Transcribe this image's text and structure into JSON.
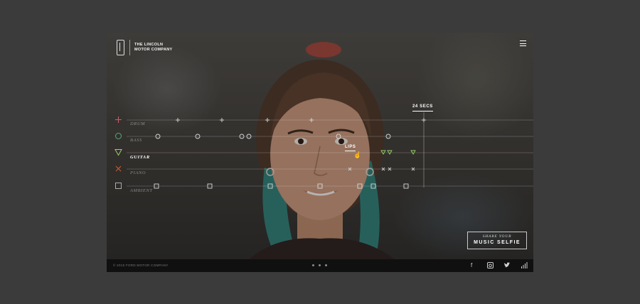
{
  "brand": {
    "line1": "THE LINCOLN",
    "line2": "MOTOR COMPANY"
  },
  "menu": {
    "icon": "hamburger-menu-icon"
  },
  "tracks": [
    {
      "label": "DRUM",
      "icon": "plus-icon",
      "color": "#c9606a",
      "active": false
    },
    {
      "label": "BASS",
      "icon": "circle-icon",
      "color": "#5aa77a",
      "active": false
    },
    {
      "label": "GUITAR",
      "icon": "triangle-icon",
      "color": "#9ad06a",
      "active": true
    },
    {
      "label": "PIANO",
      "icon": "cross-icon",
      "color": "#c8603c",
      "active": false
    },
    {
      "label": "AMBIENT",
      "icon": "square-icon",
      "color": "#aaaaaa",
      "active": false
    }
  ],
  "timer": "24 SECS",
  "hotspot": "LIPS",
  "share": {
    "line1": "SHARE YOUR",
    "line2": "MUSIC SELFIE"
  },
  "footer": {
    "copyright": "© 2015 FORD MOTOR COMPANY",
    "slides": 3,
    "social": [
      "facebook-icon",
      "instagram-icon",
      "twitter-icon",
      "signal-bars-icon"
    ]
  }
}
